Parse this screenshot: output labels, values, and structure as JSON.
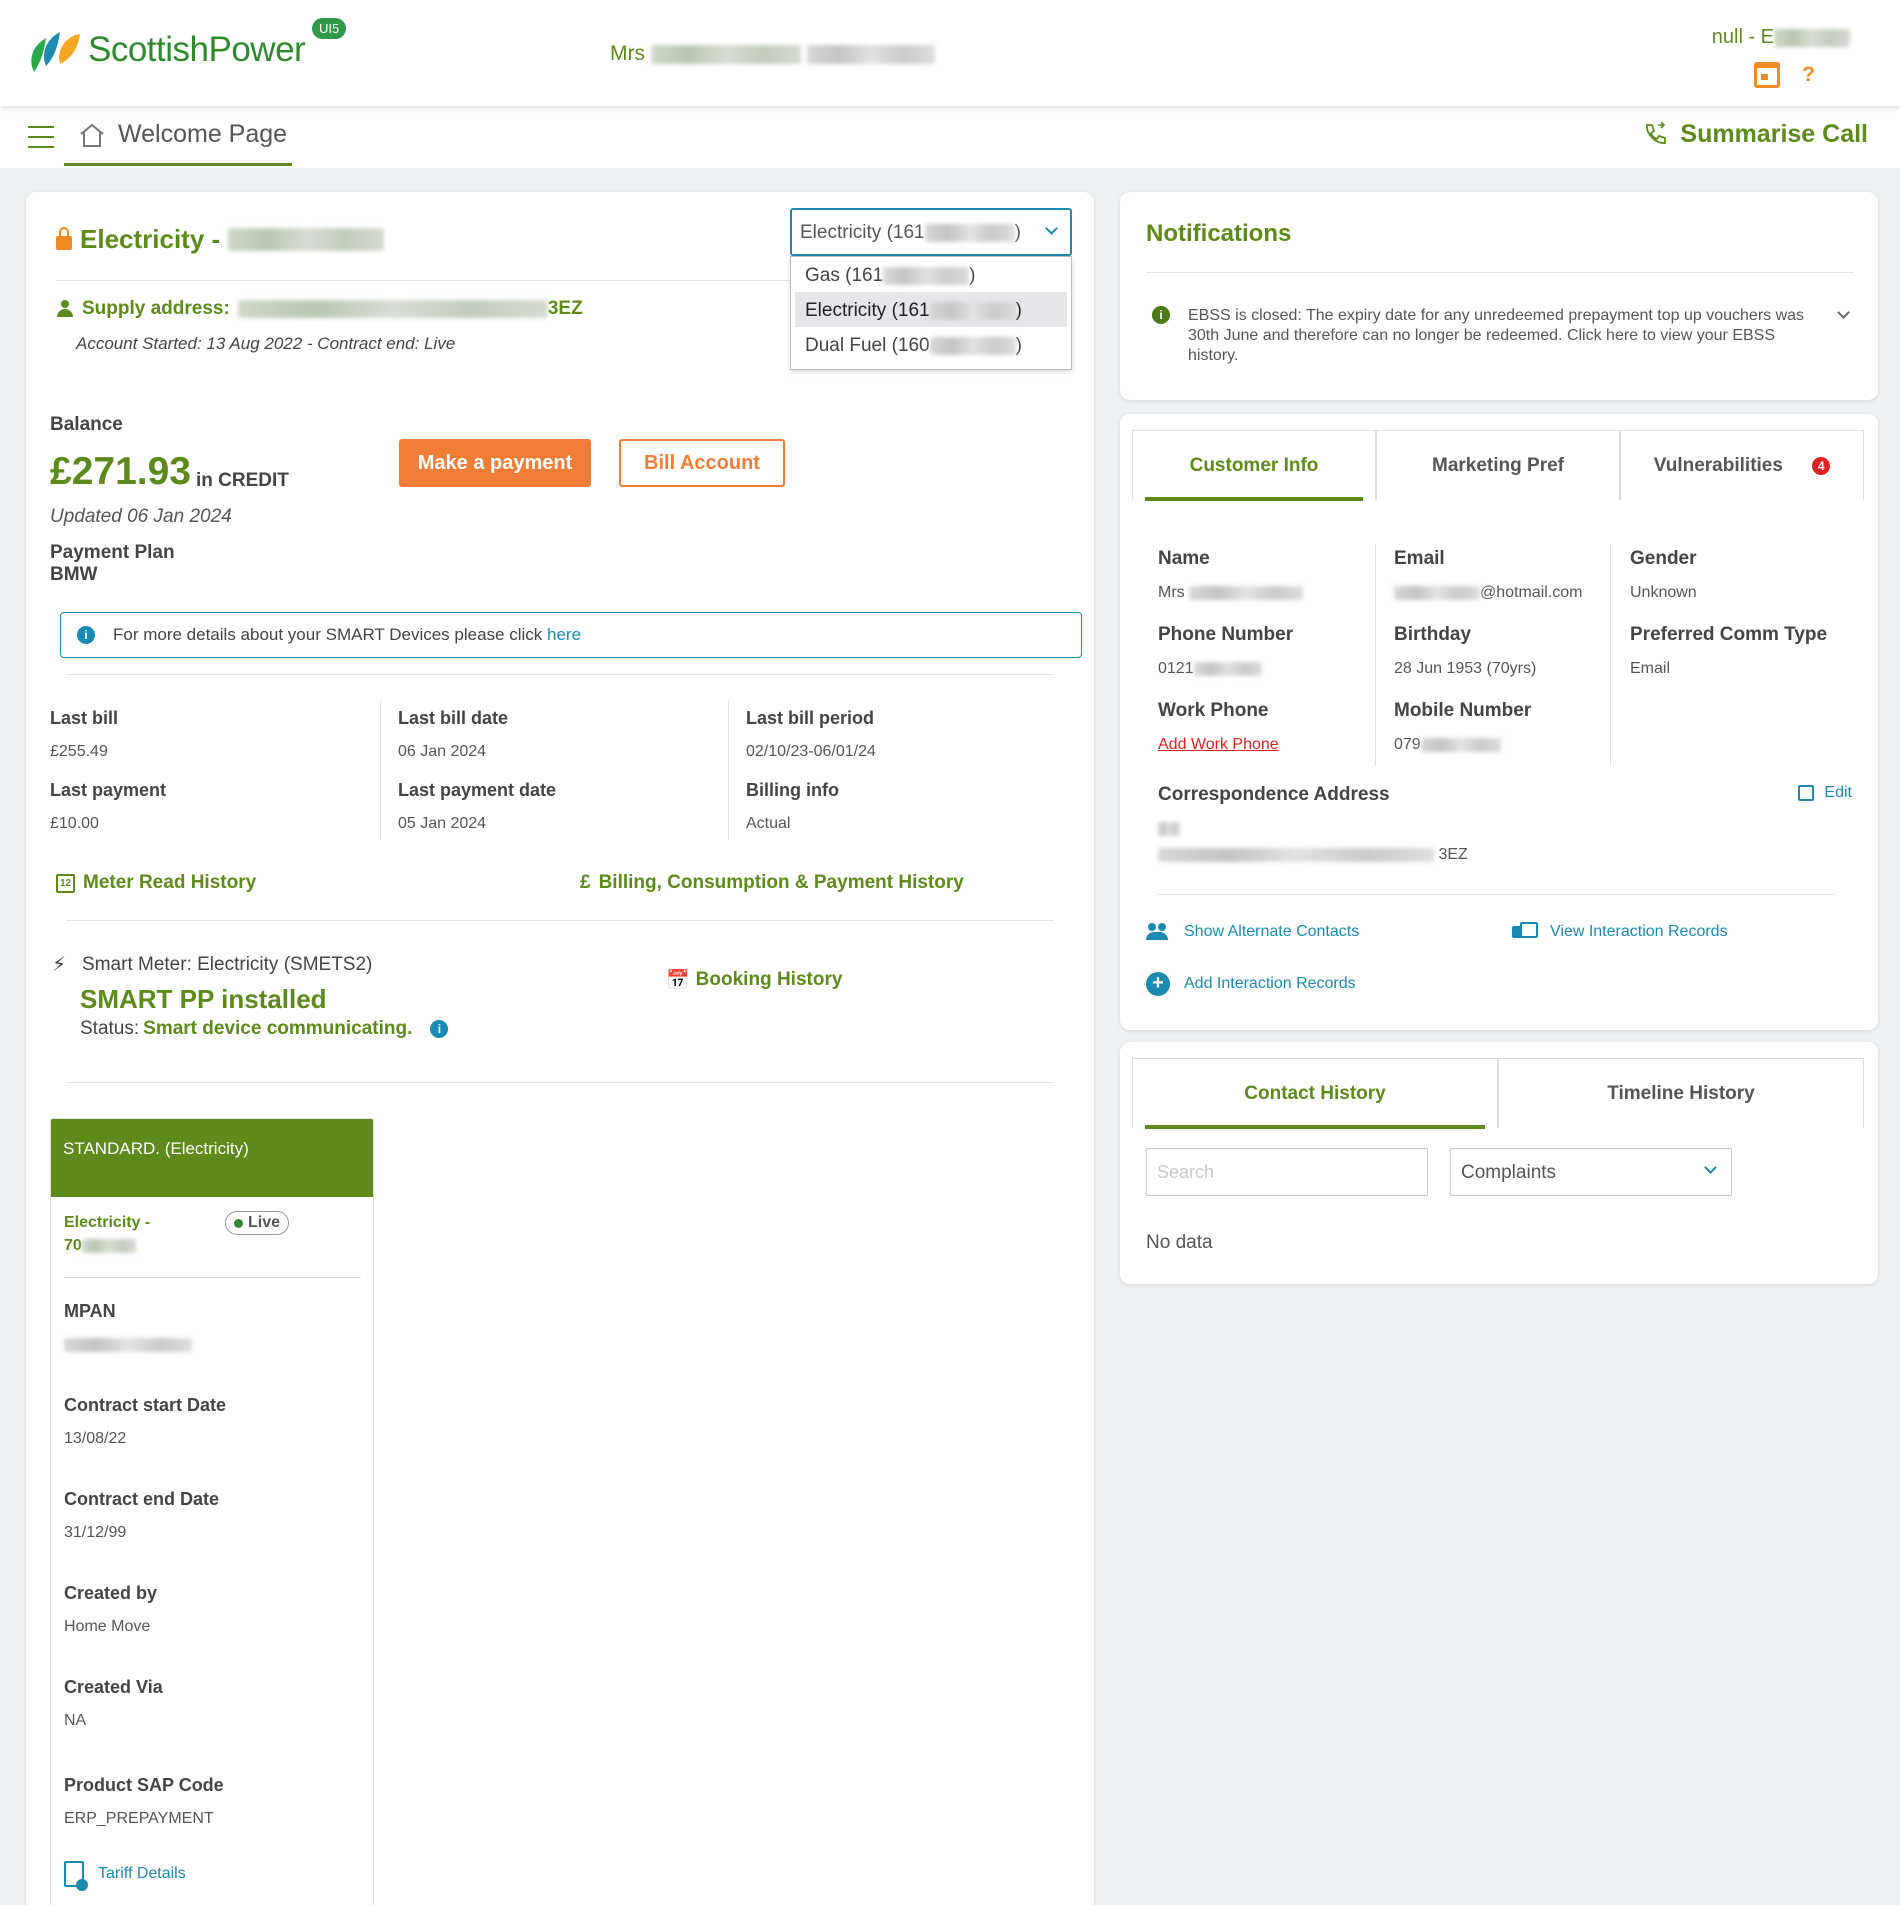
{
  "header": {
    "brand": "ScottishPower",
    "version_badge": "UI5",
    "customer_prefix": "Mrs",
    "agent_prefix": "null - E"
  },
  "subnav": {
    "page_title": "Welcome Page",
    "summarise_call": "Summarise Call"
  },
  "account": {
    "title_prefix": "Electricity -",
    "supply_label": "Supply address:",
    "postcode_suffix": "3EZ",
    "account_started": "Account Started: 13 Aug 2022 - Contract end: Live",
    "selector": {
      "selected_prefix": "Electricity (161",
      "selected_suffix": ")",
      "options": [
        {
          "prefix": "Gas (161",
          "suffix": ")"
        },
        {
          "prefix": "Electricity (161",
          "suffix": ")"
        },
        {
          "prefix": "Dual Fuel (160",
          "suffix": ")"
        }
      ],
      "highlighted_index": 1
    }
  },
  "balance": {
    "label": "Balance",
    "amount": "£271.93",
    "status": "in CREDIT",
    "updated": "Updated 06 Jan 2024",
    "payment_plan_label": "Payment Plan",
    "payment_plan_value": "BMW",
    "make_payment": "Make a payment",
    "bill_account": "Bill Account"
  },
  "smart_notice": {
    "text": "For more details about your SMART Devices please click",
    "link": "here"
  },
  "billing": {
    "last_bill": {
      "label": "Last bill",
      "value": "£255.49"
    },
    "last_bill_date": {
      "label": "Last bill date",
      "value": "06 Jan 2024"
    },
    "last_bill_period": {
      "label": "Last bill period",
      "value": "02/10/23-06/01/24"
    },
    "last_payment": {
      "label": "Last payment",
      "value": "£10.00"
    },
    "last_payment_date": {
      "label": "Last payment date",
      "value": "05 Jan 2024"
    },
    "billing_info": {
      "label": "Billing info",
      "value": "Actual"
    }
  },
  "links": {
    "meter_read_history": "Meter Read History",
    "billing_history": "Billing, Consumption & Payment History",
    "booking_history": "Booking History"
  },
  "smart_meter": {
    "label": "Smart Meter: Electricity (SMETS2)",
    "installed": "SMART PP installed",
    "status_label": "Status:",
    "status_value": "Smart device communicating."
  },
  "tariff": {
    "header": "STANDARD. (Electricity)",
    "supply_line1": "Electricity -",
    "supply_line2": "70",
    "badge": "Live",
    "fields": [
      {
        "label": "MPAN",
        "value": ""
      },
      {
        "label": "Contract start Date",
        "value": "13/08/22"
      },
      {
        "label": "Contract end Date",
        "value": "31/12/99"
      },
      {
        "label": "Created by",
        "value": "Home Move"
      },
      {
        "label": "Created Via",
        "value": "NA"
      },
      {
        "label": "Product SAP Code",
        "value": "ERP_PREPAYMENT"
      }
    ],
    "details_link": "Tariff Details"
  },
  "notifications": {
    "title": "Notifications",
    "message": "EBSS is closed: The expiry date for any unredeemed prepayment top up vouchers was 30th June and therefore can no longer be redeemed. Click here to view your EBSS history."
  },
  "customer": {
    "tabs": [
      "Customer Info",
      "Marketing Pref",
      "Vulnerabilities"
    ],
    "vulnerabilities_count": "4",
    "name": {
      "label": "Name",
      "value": "Mrs"
    },
    "email": {
      "label": "Email",
      "value": "@hotmail.com"
    },
    "gender": {
      "label": "Gender",
      "value": "Unknown"
    },
    "phone": {
      "label": "Phone Number",
      "value": "0121"
    },
    "birthday": {
      "label": "Birthday",
      "value": "28 Jun 1953 (70yrs)"
    },
    "comm_type": {
      "label": "Preferred Comm Type",
      "value": "Email"
    },
    "work_phone": {
      "label": "Work Phone",
      "value": "Add Work Phone"
    },
    "mobile": {
      "label": "Mobile Number",
      "value": "079"
    },
    "correspondence": {
      "label": "Correspondence Address",
      "postcode_suffix": "3EZ"
    },
    "edit": "Edit",
    "show_alternate_contacts": "Show Alternate Contacts",
    "view_interaction_records": "View Interaction Records",
    "add_interaction_records": "Add Interaction Records"
  },
  "history": {
    "tabs": [
      "Contact History",
      "Timeline History"
    ],
    "search_placeholder": "Search",
    "filter_value": "Complaints",
    "empty": "No data"
  },
  "colors": {
    "brand_green": "#5d8a1a",
    "accent_orange": "#f07d35",
    "link_blue": "#1a8ab0",
    "alert_red": "#e02020"
  }
}
